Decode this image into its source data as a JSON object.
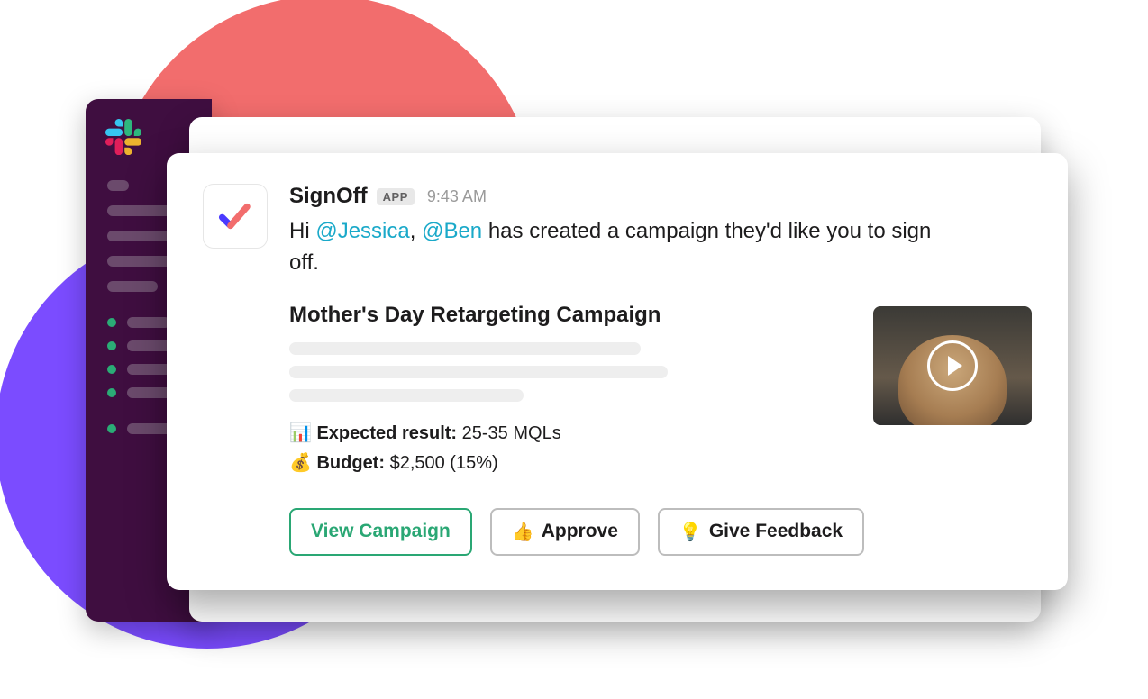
{
  "message": {
    "app_name": "SignOff",
    "app_badge": "APP",
    "timestamp": "9:43 AM",
    "text_prefix": "Hi ",
    "mention1": "@Jessica",
    "text_sep": ", ",
    "mention2": "@Ben",
    "text_suffix": " has created a campaign they'd like you to sign off."
  },
  "campaign": {
    "title": "Mother's Day Retargeting Campaign",
    "expected_icon": "📊",
    "expected_label": "Expected result:",
    "expected_value": "25-35 MQLs",
    "budget_icon": "💰",
    "budget_label": "Budget:",
    "budget_value": "$2,500 (15%)"
  },
  "actions": {
    "view": "View Campaign",
    "approve_icon": "👍",
    "approve": "Approve",
    "feedback_icon": "💡",
    "feedback": "Give Feedback"
  }
}
